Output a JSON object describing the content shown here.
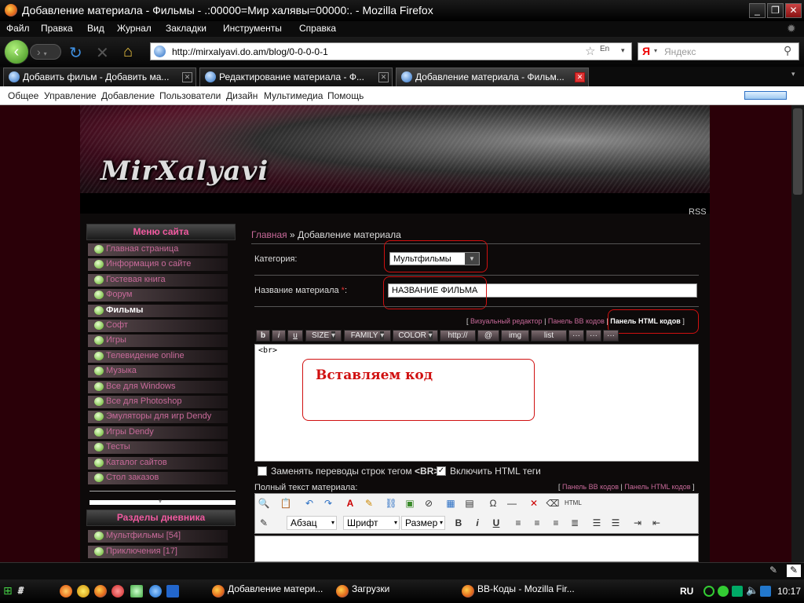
{
  "window": {
    "title": "Добавление материала - Фильмы - .:00000=Мир халявы=00000:. - Mozilla Firefox"
  },
  "menu": [
    "Файл",
    "Правка",
    "Вид",
    "Журнал",
    "Закладки",
    "Инструменты",
    "Справка"
  ],
  "nav": {
    "url": "http://mirxalyavi.do.am/blog/0-0-0-0-1",
    "lang_badge": "En",
    "search_placeholder": "Яндекс",
    "yandex_logo": "Я"
  },
  "tabs": [
    {
      "label": "Добавить фильм - Добавить ма..."
    },
    {
      "label": "Редактирование материала - Ф..."
    },
    {
      "label": "Добавление материала - Фильм..."
    }
  ],
  "ucoz": [
    "Общее",
    "Управление",
    "Добавление",
    "Пользователи",
    "Дизайн",
    "Мультимедиа",
    "Помощь"
  ],
  "site": {
    "logo": "MirXalyavi",
    "rss": "RSS"
  },
  "sidebar": {
    "menu_title": "Меню сайта",
    "items": [
      "Главная страница",
      "Информация о сайте",
      "Гостевая книга",
      "Форум",
      "Фильмы",
      "Софт",
      "Игры",
      "Телевидение online",
      "Музыка",
      "Все для Windows",
      "Все для Photoshop",
      "Эмуляторы для игр Dendy",
      "Игры Dendy",
      "Тесты",
      "Каталог сайтов",
      "Стол заказов"
    ],
    "current": "Фильмы",
    "sections_title": "Разделы дневника",
    "sections": [
      "Мультфильмы [54]",
      "Приключения [17]"
    ]
  },
  "content": {
    "breadcrumb_home": "Главная",
    "breadcrumb_sep": "»",
    "breadcrumb_current": "Добавление материала",
    "category_label": "Категория:",
    "category_value": "Мультфильмы",
    "title_label": "Название материала",
    "title_star": "*",
    "title_colon": ":",
    "title_value": "НАЗВАНИЕ ФИЛЬМА",
    "editor_links": {
      "open": "[",
      "visual": "Визуальный редактор",
      "sep": "|",
      "bb": "Панель BB кодов",
      "html": "Панель HTML кодов",
      "close": "]"
    },
    "toolbar": [
      "b",
      "i",
      "u",
      "SIZE",
      "FAMILY",
      "COLOR",
      "http://",
      "@",
      "img",
      "list",
      "···",
      "···",
      "···"
    ],
    "editor_text": "<br>",
    "annotation": "Вставляем код",
    "replace_br_label": "Заменять переводы строк тегом",
    "replace_br_tag": "<BR>",
    "html_tags_label": "Включить HTML теги",
    "fulltext_label": "Полный текст материала:",
    "fulltext_links": {
      "open": "[",
      "bb": "Панель BB кодов",
      "sep": "|",
      "html": "Панель HTML кодов",
      "close": "]"
    },
    "format": {
      "paragraph": "Абзац",
      "font": "Шрифт",
      "size": "Размер",
      "bold": "B",
      "italic": "i",
      "underline": "U"
    }
  },
  "taskbar": {
    "tasks": [
      "Добавление матери...",
      "Загрузки",
      "BB-Коды - Mozilla Fir..."
    ],
    "lang": "RU",
    "clock": "10:17"
  },
  "colors": {
    "accent_pink": "#f05aa0",
    "link_pink": "#c86a9a",
    "annotation_red": "#d01010",
    "site_bg": "#2a0008"
  }
}
